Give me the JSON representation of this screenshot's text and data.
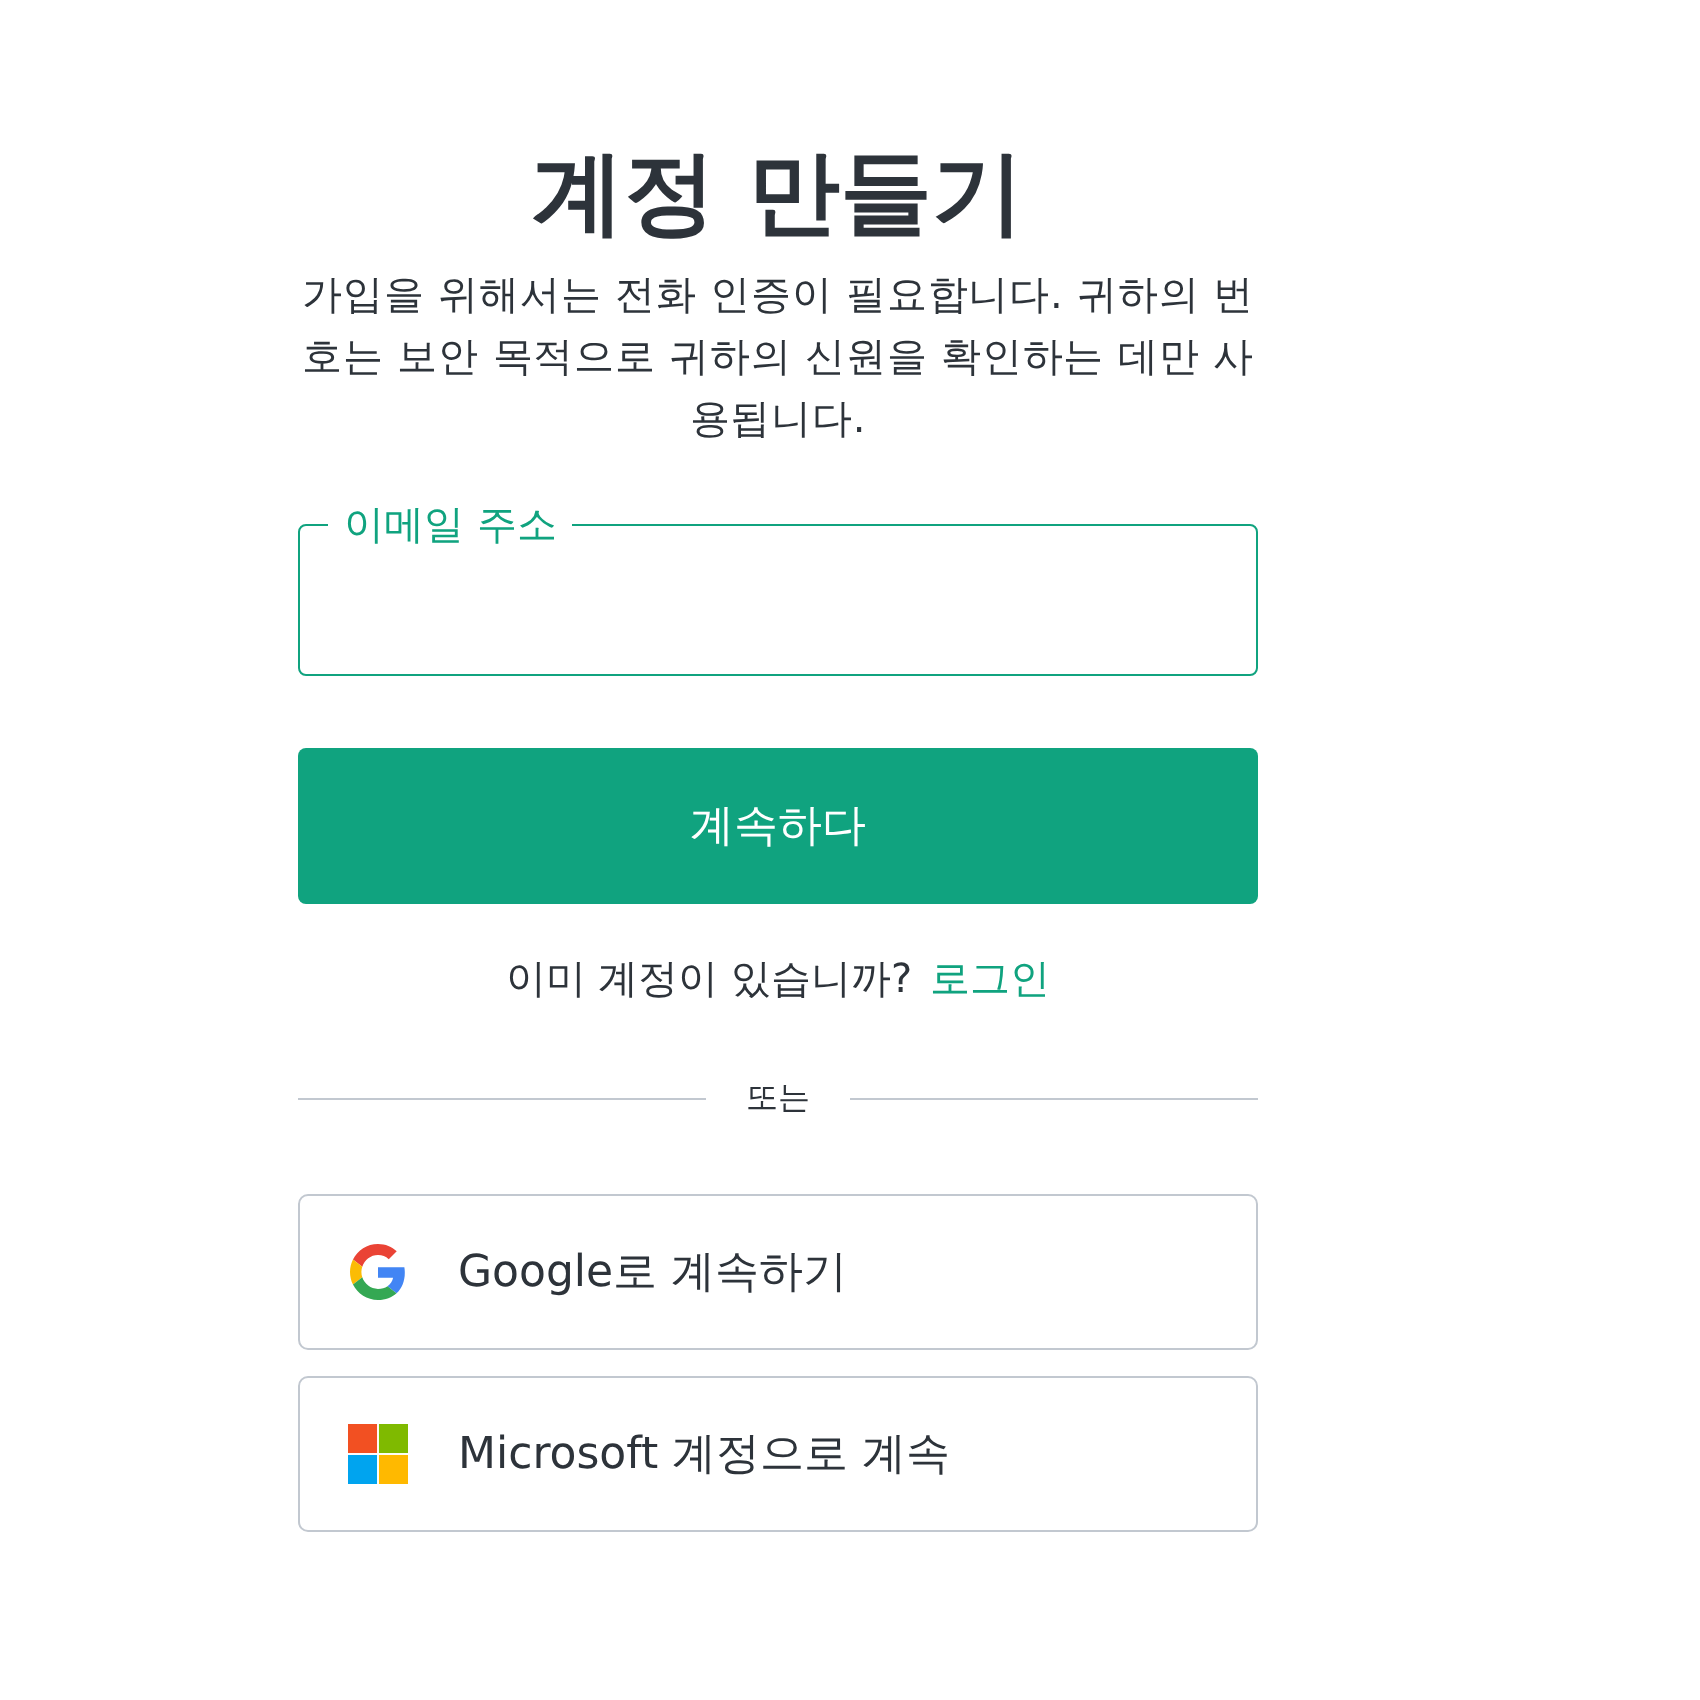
{
  "heading": "계정 만들기",
  "description": "가입을 위해서는 전화 인증이 필요합니다. 귀하의 번호는 보안 목적으로 귀하의 신원을 확인하는 데만 사용됩니다.",
  "email_field": {
    "label": "이메일 주소",
    "focused": true
  },
  "continue_button": "계속하다",
  "login_prompt": {
    "text": "이미 계정이 있습니까?",
    "link": "로그인"
  },
  "divider": "또는",
  "social_buttons": [
    {
      "kind": "google",
      "label": "Google로 계속하기"
    },
    {
      "kind": "microsoft",
      "label": "Microsoft 계정으로 계속"
    }
  ]
}
